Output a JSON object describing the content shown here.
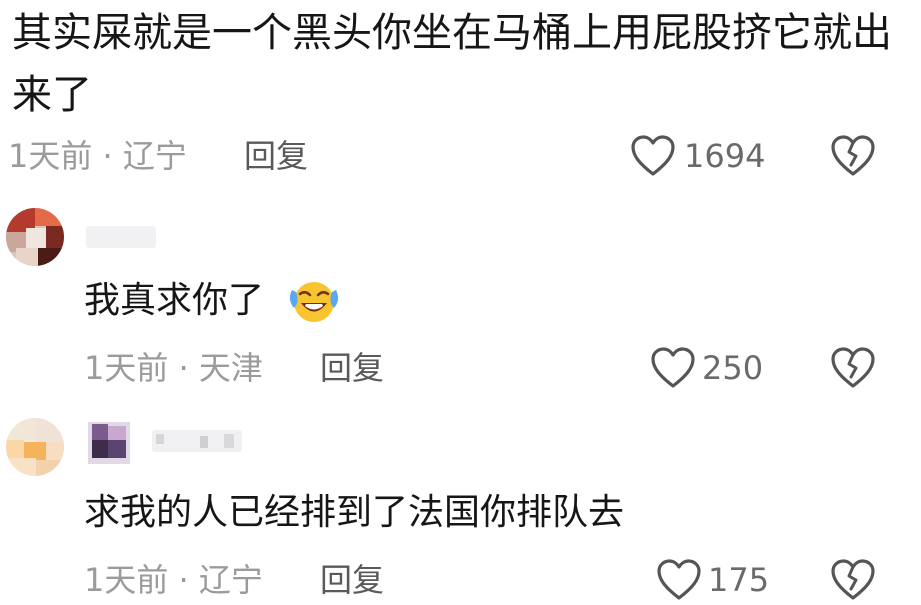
{
  "comments": [
    {
      "text": "其实屎就是一个黑头你坐在马桶上用屁股挤它就出来了",
      "meta": "1天前 · 辽宁",
      "reply_label": "回复",
      "likes": "1694"
    },
    {
      "text": "我真求你了",
      "emoji": "laughing-crying-emoji",
      "meta": "1天前 · 天津",
      "reply_label": "回复",
      "likes": "250"
    },
    {
      "text": "求我的人已经排到了法国你排队去",
      "meta": "1天前 · 辽宁",
      "reply_label": "回复",
      "likes": "175"
    }
  ],
  "icons": {
    "like": "heart-outline-icon",
    "dislike": "broken-heart-icon"
  },
  "colors": {
    "text": "#161616",
    "meta": "#9b9b9b",
    "icon": "#555555"
  }
}
